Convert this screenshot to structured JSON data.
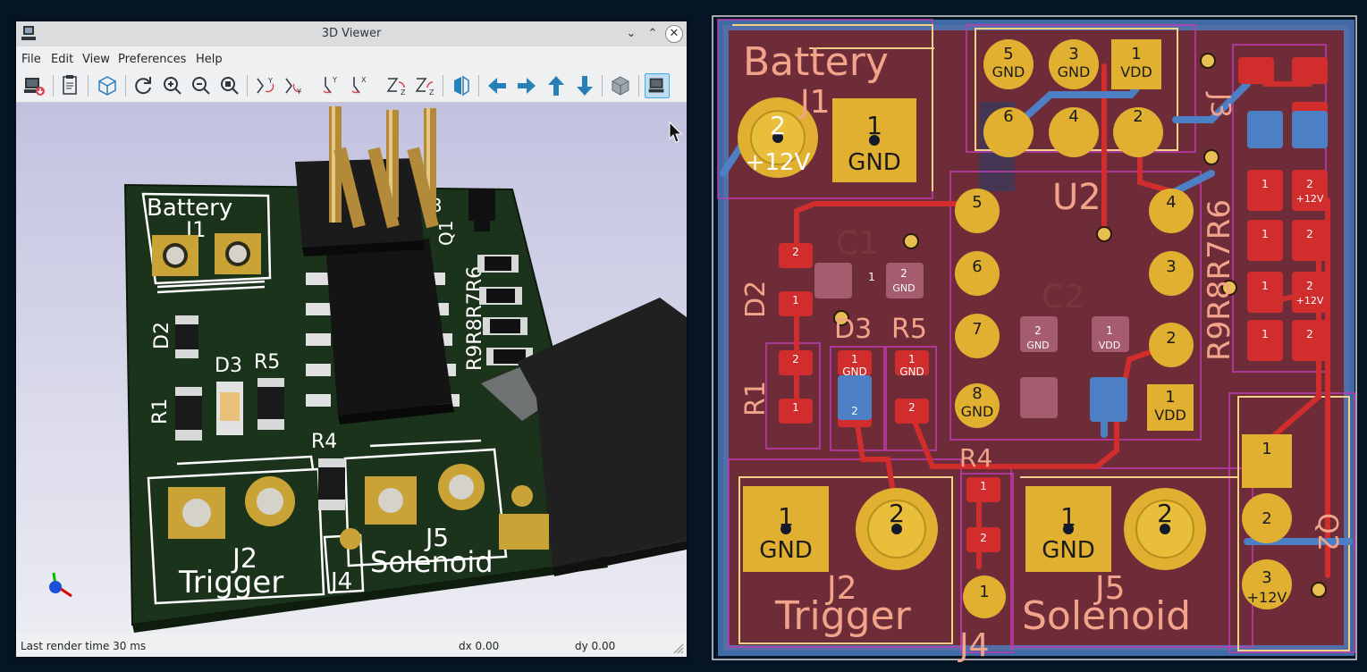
{
  "window": {
    "title": "3D Viewer",
    "controls": {
      "minimize": "⌄",
      "maximize": "⌃",
      "close": "✕"
    }
  },
  "menu": [
    "File",
    "Edit",
    "View",
    "Preferences",
    "Help"
  ],
  "toolbar": {
    "tools": [
      "render-raytrace-icon",
      "copy-clipboard-icon",
      "view-options-icon",
      "reload-icon",
      "zoom-in-icon",
      "zoom-out-icon",
      "zoom-fit-icon",
      "rotate-x-cw-icon",
      "rotate-x-ccw-icon",
      "rotate-y-cw-icon",
      "rotate-y-ccw-icon",
      "rotate-z-cw-icon",
      "rotate-z-ccw-icon",
      "flip-board-icon",
      "pan-left-icon",
      "pan-right-icon",
      "pan-up-icon",
      "pan-down-icon",
      "ortho-toggle-icon",
      "3d-view-icon"
    ]
  },
  "viewport_labels": {
    "battery": "Battery",
    "j1": "J1",
    "j2": "J2",
    "trigger": "Trigger",
    "j4": "J4",
    "j5": "J5",
    "solenoid": "Solenoid",
    "d2": "D2",
    "d3": "D3",
    "r5": "R5",
    "r1": "R1",
    "r4": "R4",
    "j3": "J3",
    "q1": "Q1",
    "r9r8r7r6": "R9R8R7R6"
  },
  "status": {
    "render_time": "Last render time 30 ms",
    "dx": "dx 0.00",
    "dy": "dy 0.00"
  },
  "pcb_labels": {
    "battery": "Battery",
    "j1": "J1",
    "plus12v": "+12V",
    "gnd": "GND",
    "u2": "U2",
    "c1": "C1",
    "c2": "C2",
    "d2": "D2",
    "d3": "D3",
    "r5": "R5",
    "r1": "R1",
    "r4": "R4",
    "j2": "J2",
    "trigger": "Trigger",
    "j4": "J4",
    "j5": "J5",
    "solenoid": "Solenoid",
    "j3": "J3",
    "q2": "Q2",
    "vdd": "VDD",
    "r9r8r7r6": "R9R8R7R6",
    "pads": {
      "p1": "1",
      "p2": "2",
      "p3": "3",
      "p4": "4",
      "p5": "5",
      "p6": "6",
      "p7": "7",
      "p8": "8"
    }
  },
  "colors": {
    "board_bg": "#061526",
    "copper_front": "#c83434",
    "copper_back": "#4d7fc4",
    "pad": "#d4a82a",
    "silk": "#f2d28b"
  }
}
